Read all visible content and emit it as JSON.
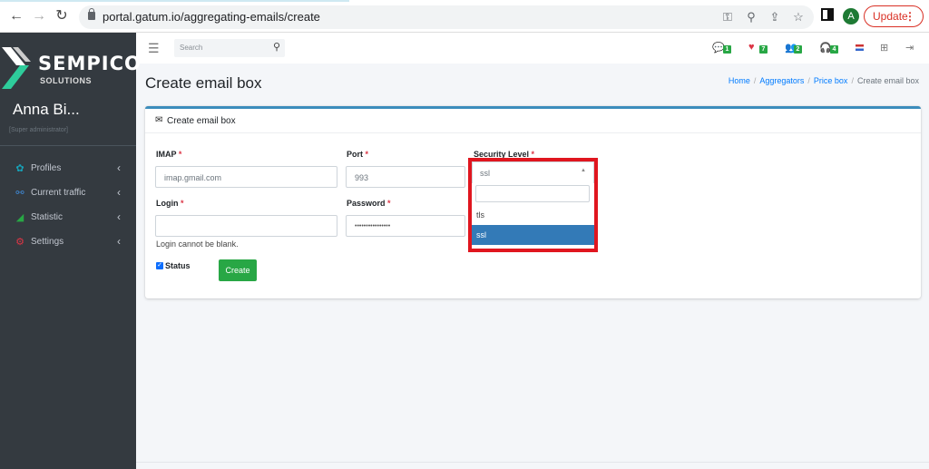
{
  "browser": {
    "url": "portal.gatum.io/aggregating-emails/create",
    "avatar_letter": "A",
    "update_label": "Update"
  },
  "sidebar": {
    "brand": "SEMPICO",
    "brand_sub": "SOLUTIONS",
    "user_name": "Anna Bi...",
    "user_role": "[Super administrator]",
    "items": [
      {
        "label": "Profiles",
        "icon": "profiles-icon",
        "color": "#17a2b8"
      },
      {
        "label": "Current traffic",
        "icon": "traffic-icon",
        "color": "#3f88d4"
      },
      {
        "label": "Statistic",
        "icon": "statistic-icon",
        "color": "#28a745"
      },
      {
        "label": "Settings",
        "icon": "settings-icon",
        "color": "#dc3545"
      }
    ]
  },
  "topbar": {
    "search_placeholder": "Search",
    "badges": {
      "messages": "1",
      "alerts": "7",
      "users": "2",
      "support": "4"
    }
  },
  "page": {
    "title": "Create email box",
    "breadcrumb": [
      "Home",
      "Aggregators",
      "Price box",
      "Create email box"
    ]
  },
  "form": {
    "card_title": "Create email box",
    "imap_label": "IMAP",
    "imap_value": "imap.gmail.com",
    "port_label": "Port",
    "port_value": "993",
    "security_label": "Security Level",
    "security_value": "ssl",
    "security_options": [
      "tls",
      "ssl"
    ],
    "login_label": "Login",
    "login_value": "",
    "login_error": "Login cannot be blank.",
    "password_label": "Password",
    "password_value": "••••••••••••••••",
    "status_label": "Status",
    "status_checked": true,
    "create_label": "Create",
    "required_mark": "*"
  },
  "colors": {
    "accent": "#3c8dbc",
    "success": "#28a745",
    "highlight": "#e0161f",
    "selected": "#337ab7"
  }
}
